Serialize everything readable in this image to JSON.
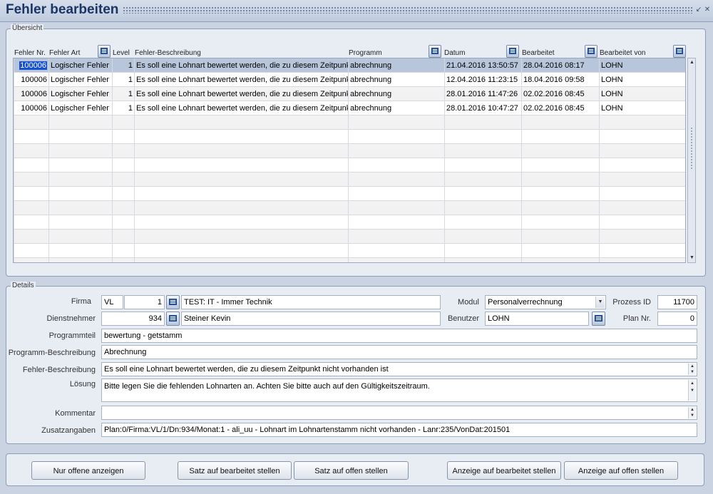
{
  "window": {
    "title": "Fehler bearbeiten"
  },
  "overview": {
    "legend": "Übersicht",
    "columns": [
      "Fehler Nr.",
      "Fehler Art",
      "Level",
      "Fehler-Beschreibung",
      "Programm",
      "Datum",
      "Bearbeitet",
      "Bearbeitet von"
    ],
    "rows": [
      [
        "100006",
        "Logischer Fehler",
        "1",
        "Es soll eine Lohnart bewertet werden, die zu diesem Zeitpunkt nicht vorhanden ist",
        "abrechnung",
        "21.04.2016 13:50:57",
        "28.04.2016 08:17",
        "LOHN"
      ],
      [
        "100006",
        "Logischer Fehler",
        "1",
        "Es soll eine Lohnart bewertet werden, die zu diesem Zeitpunkt nicht vorhanden ist",
        "abrechnung",
        "12.04.2016 11:23:15",
        "18.04.2016 09:58",
        "LOHN"
      ],
      [
        "100006",
        "Logischer Fehler",
        "1",
        "Es soll eine Lohnart bewertet werden, die zu diesem Zeitpunkt nicht vorhanden ist",
        "abrechnung",
        "28.01.2016 11:47:26",
        "02.02.2016 08:45",
        "LOHN"
      ],
      [
        "100006",
        "Logischer Fehler",
        "1",
        "Es soll eine Lohnart bewertet werden, die zu diesem Zeitpunkt nicht vorhanden ist",
        "abrechnung",
        "28.01.2016 10:47:27",
        "02.02.2016 08:45",
        "LOHN"
      ]
    ]
  },
  "details": {
    "legend": "Details",
    "firma": {
      "label": "Firma",
      "code": "VL",
      "nr": "1",
      "name": "TEST: IT - Immer Technik"
    },
    "modul": {
      "label": "Modul",
      "value": "Personalverrechnung"
    },
    "prozess": {
      "label": "Prozess ID",
      "value": "11700"
    },
    "dienstnehmer": {
      "label": "Dienstnehmer",
      "nr": "934",
      "name": "Steiner Kevin"
    },
    "benutzer": {
      "label": "Benutzer",
      "value": "LOHN"
    },
    "plan": {
      "label": "Plan Nr.",
      "value": "0"
    },
    "programmteil": {
      "label": "Programmteil",
      "value": "bewertung - getstamm"
    },
    "programm_beschreibung": {
      "label": "Programm-Beschreibung",
      "value": "Abrechnung"
    },
    "fehler_beschreibung": {
      "label": "Fehler-Beschreibung",
      "value": "Es soll eine Lohnart bewertet werden, die zu diesem Zeitpunkt nicht vorhanden ist"
    },
    "loesung": {
      "label": "Lösung",
      "value": "Bitte legen Sie die fehlenden Lohnarten an. Achten Sie bitte auch auf den Gültigkeitszeitraum."
    },
    "kommentar": {
      "label": "Kommentar",
      "value": ""
    },
    "zusatzangaben": {
      "label": "Zusatzangaben",
      "value": "Plan:0/Firma:VL/1/Dn:934/Monat:1 - ali_uu - Lohnart im Lohnartenstamm nicht vorhanden - Lanr:235/VonDat:201501"
    }
  },
  "buttons": {
    "nur_offene": "Nur offene anzeigen",
    "satz_bearbeitet": "Satz auf bearbeitet stellen",
    "satz_offen": "Satz auf offen stellen",
    "anzeige_bearbeitet": "Anzeige auf bearbeitet stellen",
    "anzeige_offen": "Anzeige auf offen stellen"
  },
  "colors": {
    "title": "#1a3566",
    "selection": "#b8c6dc",
    "highlight": "#1750d3"
  }
}
